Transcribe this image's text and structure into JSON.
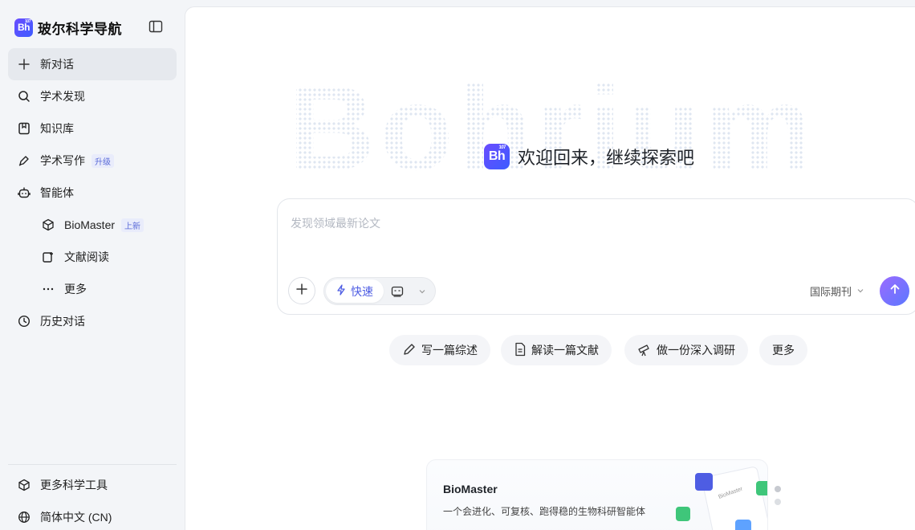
{
  "brand": {
    "logo_text": "Bh",
    "logo_sup": "107",
    "name": "玻尔科学导航"
  },
  "sidebar": {
    "items": [
      {
        "label": "新对话",
        "icon": "plus-icon"
      },
      {
        "label": "学术发现",
        "icon": "search-icon"
      },
      {
        "label": "知识库",
        "icon": "bookmark-icon"
      },
      {
        "label": "学术写作",
        "icon": "pen-icon",
        "badge": "升级"
      },
      {
        "label": "智能体",
        "icon": "robot-icon"
      },
      {
        "label": "BioMaster",
        "icon": "cube-icon",
        "badge": "上新"
      },
      {
        "label": "文献阅读",
        "icon": "document-reading-icon"
      },
      {
        "label": "更多",
        "icon": "ellipsis-icon"
      },
      {
        "label": "历史对话",
        "icon": "clock-icon"
      }
    ],
    "footer": [
      {
        "label": "更多科学工具",
        "icon": "box-icon"
      },
      {
        "label": "简体中文 (CN)",
        "icon": "globe-icon"
      }
    ]
  },
  "main": {
    "watermark": "Bohrium",
    "welcome": "欢迎回来，继续探索吧",
    "input": {
      "placeholder": "发现领域最新论文"
    },
    "mode": {
      "fast_label": "快速"
    },
    "source": {
      "label": "国际期刊"
    },
    "chips": [
      {
        "label": "写一篇综述",
        "icon": "pencil-icon"
      },
      {
        "label": "解读一篇文献",
        "icon": "file-icon"
      },
      {
        "label": "做一份深入调研",
        "icon": "telescope-icon"
      },
      {
        "label": "更多"
      }
    ],
    "card": {
      "title": "BioMaster",
      "description": "一个会进化、可复核、跑得稳的生物科研智能体",
      "art_label": "BioMaster"
    }
  },
  "colors": {
    "accent": "#4e5de3",
    "brand_gradient_start": "#6a4cff",
    "brand_gradient_end": "#3d5cff",
    "send_start": "#9b6bff",
    "send_end": "#5b78ff"
  }
}
